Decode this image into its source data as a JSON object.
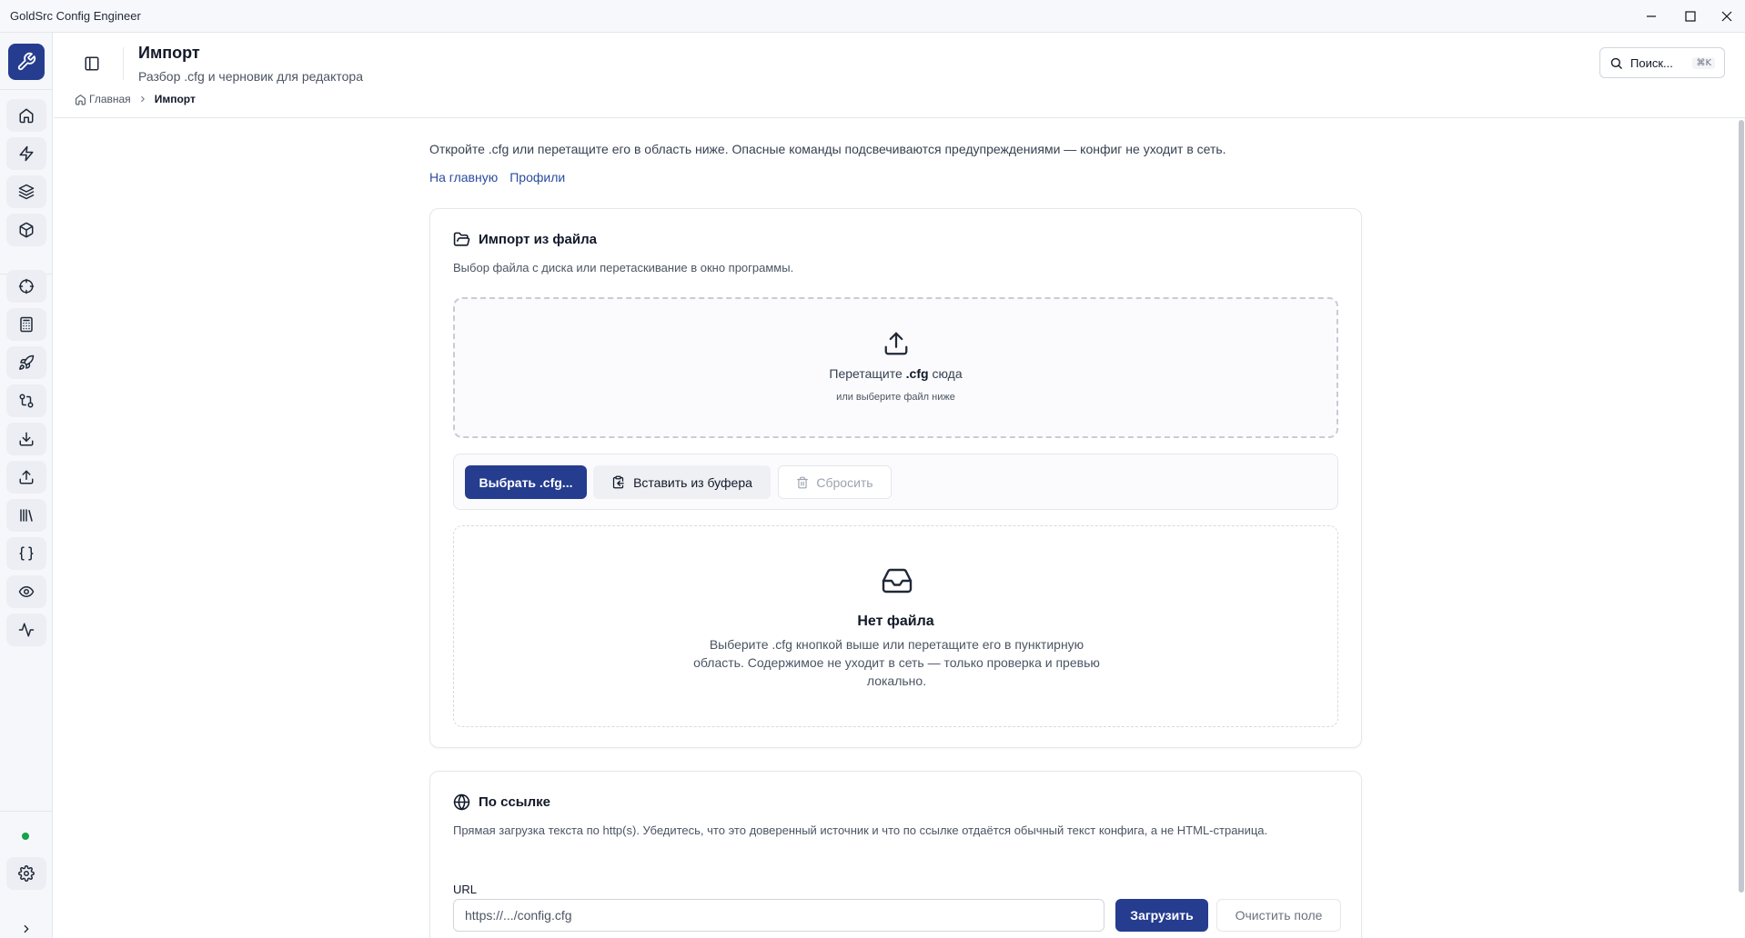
{
  "window": {
    "title": "GoldSrc Config Engineer",
    "controls": [
      "minimize-icon",
      "maximize-icon",
      "close-icon"
    ]
  },
  "sidebar": {
    "logo_icon": "wrench-icon",
    "items": [
      {
        "icon": "home-icon"
      },
      {
        "icon": "bolt-icon"
      },
      {
        "icon": "layers-icon"
      },
      {
        "icon": "package-icon"
      },
      {
        "icon": "crosshair-icon"
      },
      {
        "icon": "calculator-icon"
      },
      {
        "icon": "rocket-icon"
      },
      {
        "icon": "git-compare-icon"
      },
      {
        "icon": "download-icon"
      },
      {
        "icon": "upload-icon"
      },
      {
        "icon": "library-icon"
      },
      {
        "icon": "braces-icon"
      },
      {
        "icon": "eye-icon"
      },
      {
        "icon": "activity-icon"
      }
    ],
    "status_color": "#16a34a",
    "settings_icon": "gear-icon",
    "expand_icon": "chevron-right-icon"
  },
  "header": {
    "title": "Импорт",
    "subtitle": "Разбор .cfg и черновик для редактора",
    "breadcrumb": {
      "home": "Главная",
      "current": "Импорт"
    },
    "search": {
      "label": "Поиск...",
      "shortcut": "⌘K"
    }
  },
  "intro": {
    "text": "Откройте .cfg или перетащите его в область ниже. Опасные команды подсвечиваются предупреждениями — конфиг не уходит в сеть.",
    "links": [
      "На главную",
      "Профили"
    ]
  },
  "file_import": {
    "title": "Импорт из файла",
    "description": "Выбор файла с диска или перетаскивание в окно программы.",
    "dropzone": {
      "title_before": "Перетащите ",
      "title_ext": ".cfg",
      "title_after": " сюда",
      "hint": "или выберите файл ниже"
    },
    "buttons": {
      "choose": "Выбрать .cfg...",
      "paste": "Вставить из буфера",
      "reset": "Сбросить"
    },
    "empty": {
      "title": "Нет файла",
      "description": "Выберите .cfg кнопкой выше или перетащите его в пунктирную область. Содержимое не уходит в сеть — только проверка и превью локально."
    }
  },
  "url_import": {
    "title": "По ссылке",
    "description": "Прямая загрузка текста по http(s). Убедитесь, что это доверенный источник и что по ссылке отдаётся обычный текст конфига, а не HTML-страница.",
    "label": "URL",
    "placeholder": "https://.../config.cfg",
    "value": "",
    "load": "Загрузить",
    "clear": "Очистить поле"
  },
  "colors": {
    "accent": "#253c8f",
    "link": "#2a4c9e",
    "status_online": "#16a34a"
  }
}
